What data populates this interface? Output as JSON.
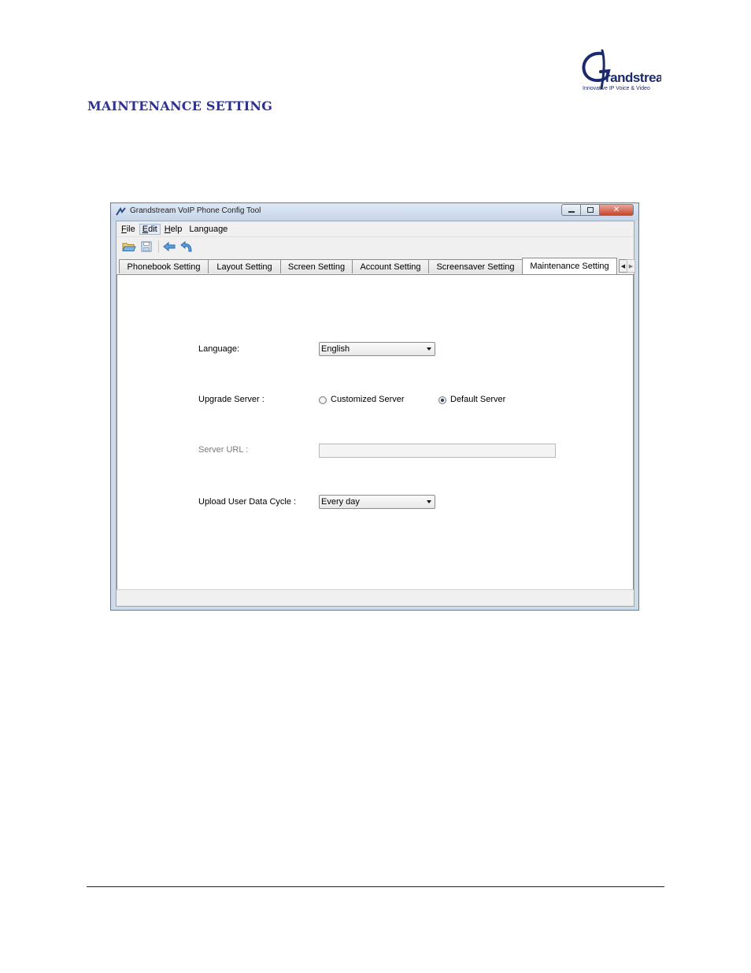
{
  "document": {
    "logo_text": "Grandstream",
    "logo_tagline": "Innovative IP Voice & Video",
    "section_heading": "MAINTENANCE SETTING"
  },
  "window": {
    "title": "Grandstream VoIP Phone Config Tool",
    "controls": {
      "close": "✕"
    }
  },
  "menu": [
    {
      "key": "F",
      "rest": "ile"
    },
    {
      "key": "E",
      "rest": "dit"
    },
    {
      "key": "H",
      "rest": "elp"
    },
    {
      "key": "",
      "rest": "Language"
    }
  ],
  "toolbar": {
    "icons": [
      "open-folder-icon",
      "save-icon",
      "back-arrow-icon",
      "undo-icon"
    ]
  },
  "tabs": [
    {
      "label": "Phonebook Setting",
      "active": false
    },
    {
      "label": "Layout Setting",
      "active": false
    },
    {
      "label": "Screen Setting",
      "active": false
    },
    {
      "label": "Account Setting",
      "active": false
    },
    {
      "label": "Screensaver Setting",
      "active": false
    },
    {
      "label": "Maintenance Setting",
      "active": true
    }
  ],
  "form": {
    "language_label": "Language:",
    "language_value": "English",
    "upgrade_server_label": "Upgrade Server :",
    "radio_customized": "Customized  Server",
    "radio_default": "Default Server",
    "selected_server": "Default Server",
    "server_url_label": "Server URL :",
    "server_url_value": "",
    "upload_cycle_label": "Upload User Data Cycle :",
    "upload_cycle_value": "Every day"
  }
}
